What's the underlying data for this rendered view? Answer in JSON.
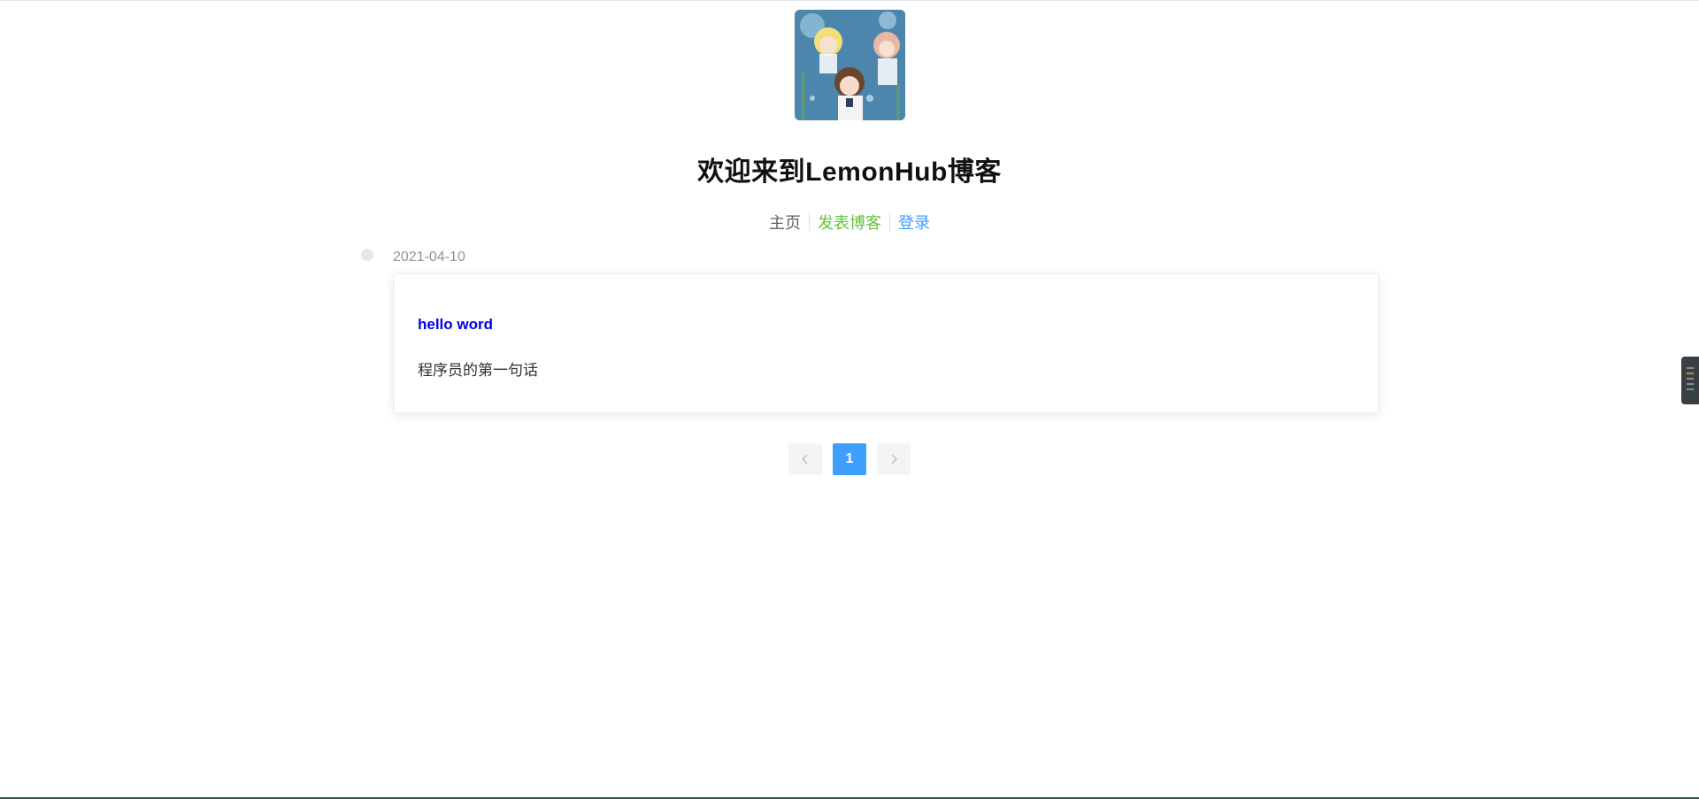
{
  "header": {
    "avatar_alt": "anime avatar",
    "site_title": "欢迎来到LemonHub博客"
  },
  "nav": {
    "home": "主页",
    "post": "发表博客",
    "login": "登录"
  },
  "timeline": {
    "date": "2021-04-10",
    "post_title": "hello word",
    "post_desc": "程序员的第一句话"
  },
  "pagination": {
    "prev_icon": "chevron-left-icon",
    "current_page": "1",
    "next_icon": "chevron-right-icon"
  },
  "colors": {
    "accent": "#409eff",
    "green": "#67c23a",
    "link": "#0000ee"
  }
}
